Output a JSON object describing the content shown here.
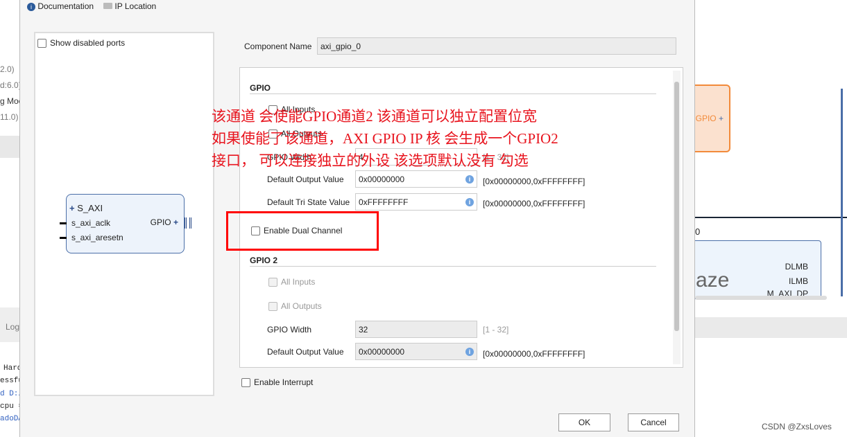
{
  "background": {
    "left_fragments": [
      "2.0)",
      "d:6.0)",
      "g Moc",
      "11.0)",
      "Log",
      "Hard",
      "essfu",
      "d D:/",
      "cpu =",
      "adoDA"
    ],
    "right_canvas": {
      "gpio_block_label": "GPIO",
      "block_label": "0",
      "logo_text": "aze",
      "ports": [
        "DLMB",
        "ILMB",
        "M_AXI_DP"
      ]
    },
    "watermark": "CSDN @ZxsLoves"
  },
  "dialog": {
    "top_tabs": [
      {
        "label": "Documentation",
        "icon": "info-icon"
      },
      {
        "label": "IP Location",
        "icon": "folder-icon"
      }
    ],
    "left_panel": {
      "show_disabled_ports": {
        "label": "Show disabled ports",
        "checked": false
      },
      "block": {
        "ports_left": [
          "S_AXI",
          "s_axi_aclk",
          "s_axi_aresetn"
        ],
        "ports_right": [
          "GPIO"
        ]
      }
    },
    "component_name": {
      "label": "Component Name",
      "value": "axi_gpio_0"
    },
    "gpio": {
      "header": "GPIO",
      "all_inputs": {
        "label": "All Inputs",
        "checked": false
      },
      "all_outputs": {
        "label": "All Outputs",
        "checked": false
      },
      "gpio_width": {
        "label": "GPIO Width",
        "value": "4",
        "range": "[1 - 32]"
      },
      "default_output": {
        "label": "Default Output Value",
        "value": "0x00000000",
        "range": "[0x00000000,0xFFFFFFFF]"
      },
      "default_tri": {
        "label": "Default Tri State Value",
        "value": "0xFFFFFFFF",
        "range": "[0x00000000,0xFFFFFFFF]"
      }
    },
    "dual_channel": {
      "label": "Enable Dual Channel",
      "checked": false
    },
    "gpio2": {
      "header": "GPIO 2",
      "all_inputs": {
        "label": "All Inputs"
      },
      "all_outputs": {
        "label": "All Outputs"
      },
      "gpio_width": {
        "label": "GPIO Width",
        "value": "32",
        "range": "[1 - 32]"
      },
      "default_output": {
        "label": "Default Output Value",
        "value": "0x00000000",
        "range": "[0x00000000,0xFFFFFFFF]"
      }
    },
    "enable_interrupt": {
      "label": "Enable Interrupt",
      "checked": false
    },
    "ok": "OK",
    "cancel": "Cancel"
  },
  "annotation": {
    "lines": [
      "该通道 会使能GPIO通道2 该通道可以独立配置位宽",
      "如果使能了该通道，AXI GPIO IP 核 会生成一个GPIO2",
      "接口， 可以连接独立的外设 该选项默认没有 勾选"
    ],
    "color": "#e8141e"
  }
}
